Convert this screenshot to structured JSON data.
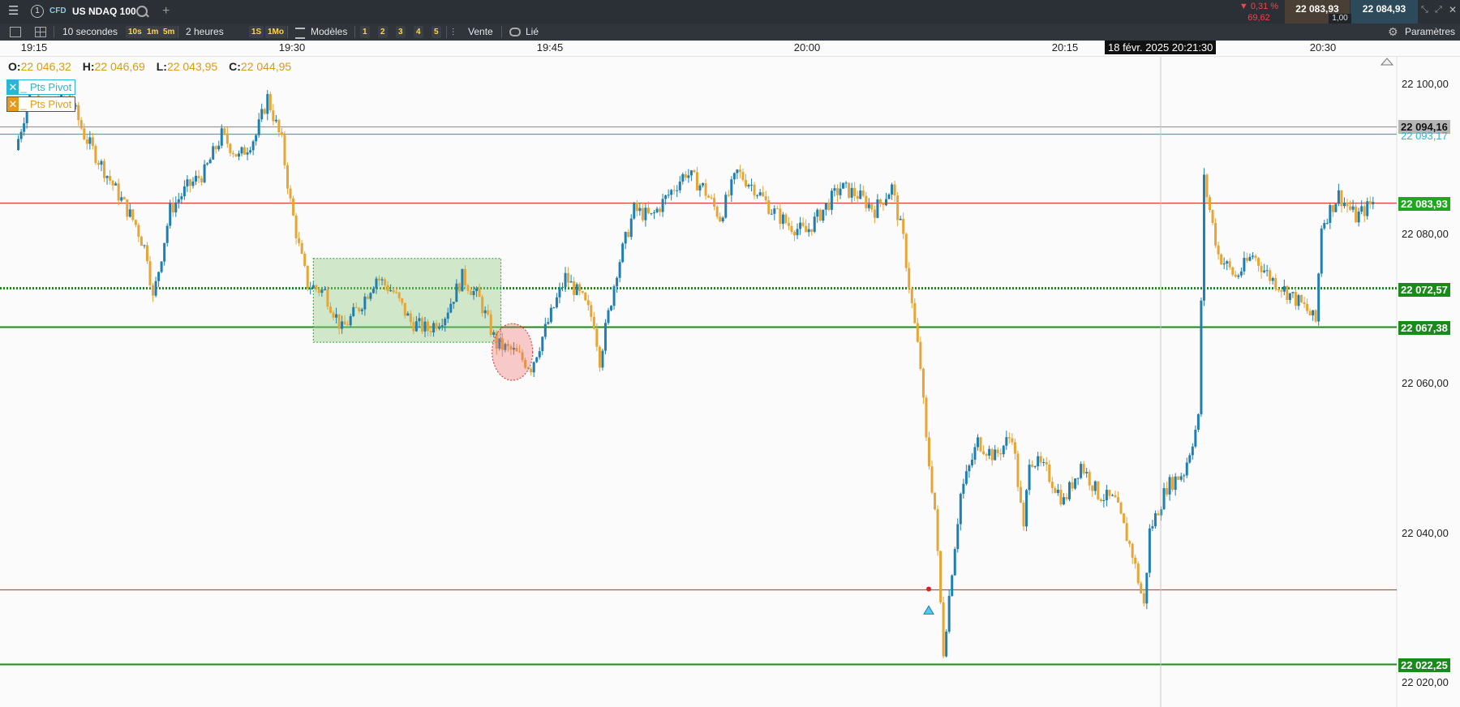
{
  "instrument": {
    "badge": "CFD",
    "name": "US NDAQ 100",
    "number": "1"
  },
  "quote": {
    "change_pct": "▼ 0,31 %",
    "change_abs": "69,62",
    "bid": "22 083,93",
    "ask": "22 084,93",
    "spread": "1,00"
  },
  "toolbar": {
    "interval": "10 secondes",
    "quick_intervals": [
      "10s",
      "1m",
      "5m"
    ],
    "period": "2 heures",
    "quick_periods": [
      "1S",
      "1Mo"
    ],
    "templates_label": "Modèles",
    "template_slots": [
      "1",
      "2",
      "3",
      "4",
      "5"
    ],
    "sell_label": "Vente",
    "link_label": "Lié",
    "settings_label": "Paramètres"
  },
  "time_axis": {
    "labels": [
      "19:15",
      "19:30",
      "19:45",
      "20:00",
      "20:15",
      "20:30"
    ],
    "crosshair_label": "18 févr. 2025 20:21:30"
  },
  "ohlc": {
    "o_label": "O:",
    "o": "22 046,32",
    "h_label": "H:",
    "h": "22 046,69",
    "l_label": "L:",
    "l": "22 043,95",
    "c_label": "C:",
    "c": "22 044,95"
  },
  "legend": [
    {
      "label": "Pts Pivot",
      "color": "#2ab6d6"
    },
    {
      "label": "Pts Pivot",
      "color": "#e59a1c"
    }
  ],
  "colors": {
    "up": "#1f7fb0",
    "down": "#e6a534",
    "resistance": "#e04040",
    "support": "#1a8a1a",
    "pivot_blue": "#2ab6d6",
    "box_fill": "#9ccf8f",
    "highlight": "#f26d6d"
  },
  "chart_data": {
    "type": "candlestick",
    "x_unit": "time",
    "y_ticks": [
      "22 100,00",
      "22 080,00",
      "22 060,00",
      "22 040,00",
      "22 020,00"
    ],
    "y_tick_values": [
      22100,
      22080,
      22060,
      22040,
      22020
    ],
    "ylim": [
      22016.3,
      22104.7
    ],
    "xlim": [
      "19:14:00",
      "20:36:00"
    ],
    "price_lines": [
      {
        "value": 22094.16,
        "label": "22 094,16",
        "color": "#9a9a9a",
        "style": "solid"
      },
      {
        "value": 22093.17,
        "label": "22 093,17",
        "color": "#2ab6d6",
        "style": "solid"
      },
      {
        "value": 22083.93,
        "label": "22 083,93",
        "color": "#e04040",
        "style": "solid"
      },
      {
        "value": 22072.57,
        "label": "22 072,57",
        "color": "#1a8a1a",
        "style": "dotted"
      },
      {
        "value": 22067.38,
        "label": "22 067,38",
        "color": "#1a8a1a",
        "style": "solid"
      },
      {
        "value": 22032.3,
        "label": "",
        "color": "#e04040",
        "style": "solid"
      },
      {
        "value": 22022.25,
        "label": "22 022,25",
        "color": "#1a8a1a",
        "style": "solid"
      }
    ],
    "last_price": "22 083,93",
    "zone": {
      "t_start": "19:31:15",
      "t_end": "19:42:10",
      "y_high": 22076.5,
      "y_low": 22065.3
    },
    "highlight_point": {
      "t": "19:42:50",
      "y": 22064.0
    },
    "marker": {
      "t": "20:21:30"
    },
    "path": [
      [
        "19:14:00",
        22091
      ],
      [
        "19:15:00",
        22100
      ],
      [
        "19:16:00",
        22096
      ],
      [
        "19:17:00",
        22099
      ],
      [
        "19:18:00",
        22093
      ],
      [
        "19:19:00",
        22089
      ],
      [
        "19:20:00",
        22085
      ],
      [
        "19:21:00",
        22081
      ],
      [
        "19:21:40",
        22077
      ],
      [
        "19:22:00",
        22071
      ],
      [
        "19:23:00",
        22083
      ],
      [
        "19:24:00",
        22086
      ],
      [
        "19:25:00",
        22088
      ],
      [
        "19:26:00",
        22093
      ],
      [
        "19:27:00",
        22090
      ],
      [
        "19:28:00",
        22093
      ],
      [
        "19:28:40",
        22098
      ],
      [
        "19:29:30",
        22092
      ],
      [
        "19:30:00",
        22084
      ],
      [
        "19:30:30",
        22078
      ],
      [
        "19:31:00",
        22073
      ],
      [
        "19:32:00",
        22072
      ],
      [
        "19:33:00",
        22067
      ],
      [
        "19:34:00",
        22070
      ],
      [
        "19:35:00",
        22074
      ],
      [
        "19:36:00",
        22072
      ],
      [
        "19:37:00",
        22068
      ],
      [
        "19:38:00",
        22067
      ],
      [
        "19:39:00",
        22069
      ],
      [
        "19:40:00",
        22074
      ],
      [
        "19:41:00",
        22071
      ],
      [
        "19:42:00",
        22065
      ],
      [
        "19:43:00",
        22064
      ],
      [
        "19:44:00",
        22062
      ],
      [
        "19:45:00",
        22068
      ],
      [
        "19:46:00",
        22074
      ],
      [
        "19:47:00",
        22071
      ],
      [
        "19:47:40",
        22068
      ],
      [
        "19:48:00",
        22063
      ],
      [
        "19:49:00",
        22075
      ],
      [
        "19:50:00",
        22083
      ],
      [
        "19:51:00",
        22082
      ],
      [
        "19:52:00",
        22085
      ],
      [
        "19:53:00",
        22088
      ],
      [
        "19:54:00",
        22086
      ],
      [
        "19:55:00",
        22082
      ],
      [
        "19:56:00",
        22088
      ],
      [
        "19:57:00",
        22086
      ],
      [
        "19:58:00",
        22083
      ],
      [
        "19:59:00",
        22081
      ],
      [
        "20:00:00",
        22080
      ],
      [
        "20:01:00",
        22083
      ],
      [
        "20:02:00",
        22086
      ],
      [
        "20:03:00",
        22085
      ],
      [
        "20:04:00",
        22083
      ],
      [
        "20:05:00",
        22086
      ],
      [
        "20:05:40",
        22079
      ],
      [
        "20:06:00",
        22073
      ],
      [
        "20:06:40",
        22062
      ],
      [
        "20:07:00",
        22052
      ],
      [
        "20:07:30",
        22043
      ],
      [
        "20:08:00",
        22024
      ],
      [
        "20:08:30",
        22035
      ],
      [
        "20:09:00",
        22045
      ],
      [
        "20:10:00",
        22052
      ],
      [
        "20:11:00",
        22050
      ],
      [
        "20:12:00",
        22053
      ],
      [
        "20:12:40",
        22040
      ],
      [
        "20:13:00",
        22050
      ],
      [
        "20:14:00",
        22048
      ],
      [
        "20:15:00",
        22044
      ],
      [
        "20:16:00",
        22049
      ],
      [
        "20:17:00",
        22045
      ],
      [
        "20:18:00",
        22044
      ],
      [
        "20:19:00",
        22037
      ],
      [
        "20:19:40",
        22030
      ],
      [
        "20:20:00",
        22040
      ],
      [
        "20:21:00",
        22046
      ],
      [
        "20:22:00",
        22048
      ],
      [
        "20:22:50",
        22055
      ],
      [
        "20:23:10",
        22087
      ],
      [
        "20:24:00",
        22077
      ],
      [
        "20:25:00",
        22074
      ],
      [
        "20:26:00",
        22077
      ],
      [
        "20:27:00",
        22074
      ],
      [
        "20:28:00",
        22072
      ],
      [
        "20:29:00",
        22070
      ],
      [
        "20:29:40",
        22068
      ],
      [
        "20:30:00",
        22081
      ],
      [
        "20:31:00",
        22085
      ],
      [
        "20:32:00",
        22082
      ],
      [
        "20:33:00",
        22084
      ]
    ]
  }
}
